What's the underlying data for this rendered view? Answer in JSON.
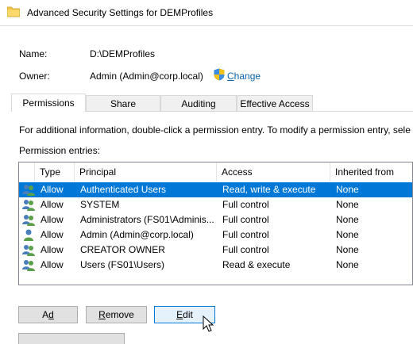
{
  "window": {
    "title": "Advanced Security Settings for DEMProfiles"
  },
  "name_label": "Name:",
  "name_value": "D:\\DEMProfiles",
  "owner_label": "Owner:",
  "owner_value": "Admin (Admin@corp.local)",
  "change_link": {
    "accel": "C",
    "rest": "hange"
  },
  "tabs": [
    {
      "label": "Permissions",
      "active": true
    },
    {
      "label": "Share"
    },
    {
      "label": "Auditing"
    },
    {
      "label": "Effective Access"
    }
  ],
  "info_text": "For additional information, double-click a permission entry. To modify a permission entry, sele",
  "entries_label": "Permission entries:",
  "columns": [
    "Type",
    "Principal",
    "Access",
    "Inherited from"
  ],
  "rows": [
    {
      "type": "Allow",
      "principal": "Authenticated Users",
      "access": "Read, write & execute",
      "inherited": "None",
      "icon": "users-group-icon",
      "selected": true
    },
    {
      "type": "Allow",
      "principal": "SYSTEM",
      "access": "Full control",
      "inherited": "None",
      "icon": "users-group-icon"
    },
    {
      "type": "Allow",
      "principal": "Administrators (FS01\\Adminis...",
      "access": "Full control",
      "inherited": "None",
      "icon": "users-group-icon"
    },
    {
      "type": "Allow",
      "principal": "Admin (Admin@corp.local)",
      "access": "Full control",
      "inherited": "None",
      "icon": "user-icon"
    },
    {
      "type": "Allow",
      "principal": "CREATOR OWNER",
      "access": "Full control",
      "inherited": "None",
      "icon": "users-group-icon"
    },
    {
      "type": "Allow",
      "principal": "Users (FS01\\Users)",
      "access": "Read & execute",
      "inherited": "None",
      "icon": "users-group-icon"
    }
  ],
  "buttons": {
    "add": {
      "accel": "d",
      "pre": "A",
      "post": ""
    },
    "remove": {
      "accel": "R",
      "pre": "",
      "post": "emove"
    },
    "edit": {
      "accel": "E",
      "pre": "",
      "post": "dit"
    }
  },
  "colors": {
    "selection": "#0078d7",
    "link": "#0a64ae",
    "folder": "#f5c84c"
  }
}
